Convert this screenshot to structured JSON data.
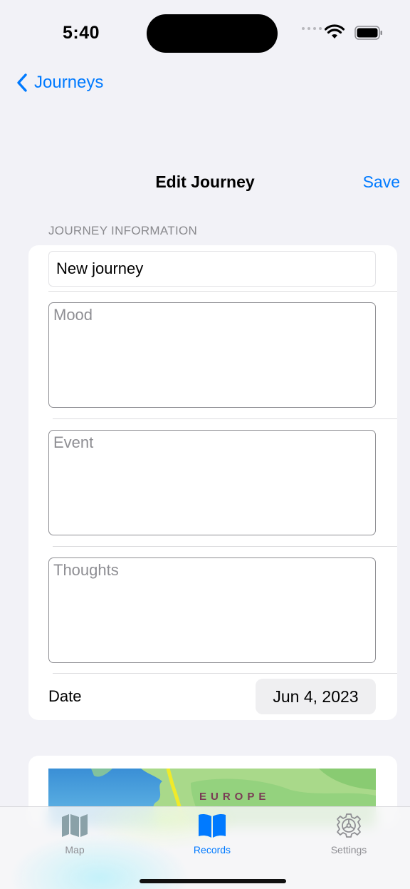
{
  "status_bar": {
    "time": "5:40"
  },
  "nav": {
    "back_label": "Journeys",
    "title": "Edit Journey",
    "save_label": "Save"
  },
  "form": {
    "section_header": "JOURNEY INFORMATION",
    "title_value": "New journey",
    "mood_placeholder": "Mood",
    "event_placeholder": "Event",
    "thoughts_placeholder": "Thoughts",
    "date_label": "Date",
    "date_value": "Jun 4, 2023"
  },
  "map": {
    "region_label": "EUROPE"
  },
  "tabs": [
    {
      "label": "Map",
      "icon": "map-icon",
      "active": false
    },
    {
      "label": "Records",
      "icon": "book-icon",
      "active": true
    },
    {
      "label": "Settings",
      "icon": "gear-icon",
      "active": false
    }
  ],
  "colors": {
    "accent": "#007aff",
    "background": "#f2f2f7",
    "inactive_tab": "#8e8e93"
  }
}
